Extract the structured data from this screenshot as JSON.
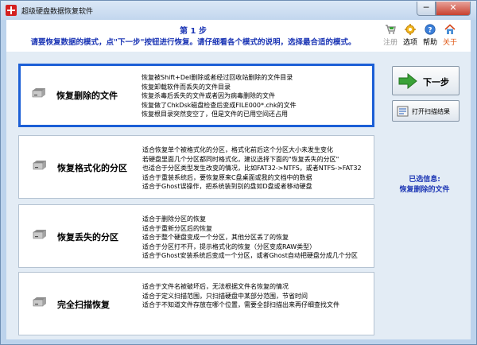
{
  "window": {
    "title": "超级硬盘数据恢复软件",
    "controls": {
      "minimize": "─",
      "close": "✕"
    }
  },
  "header": {
    "step": "第 1 步",
    "instruction": "请要恢复数据的模式，点\"下一步\"按钮进行恢复。请仔细看各个模式的说明，选择最合适的模式。"
  },
  "toolbar": {
    "register": "注册",
    "options": "选项",
    "help": "帮助",
    "about": "关于"
  },
  "options": [
    {
      "title": "恢复删除的文件",
      "lines": [
        "恢复被Shift+Del删除或者经过回收站删除的文件目录",
        "恢复卸载软件而丢失的文件目录",
        "恢复杀毒后丢失的文件或者因为病毒删除的文件",
        "恢复做了ChkDsk磁盘检查后变成FILE000*.chk的文件",
        "恢复根目录突然变空了，但是文件的已用空间还占用"
      ]
    },
    {
      "title": "恢复格式化的分区",
      "lines": [
        "适合恢复单个被格式化的分区，格式化前后这个分区大小未发生变化",
        "若硬盘里面几个分区都同时格式化，建议选择下面的\"恢复丢失的分区\"",
        "也适合于分区类型发生改变的情况，比如FAT32->NTFS，或者NTFS->FAT32",
        "适合于重装系统后，要恢复原来C盘桌面或我的文档中的数据",
        "适合于Ghost误操作，把系统装到别的盘如D盘或者移动硬盘"
      ]
    },
    {
      "title": "恢复丢失的分区",
      "lines": [
        "适合于删除分区的恢复",
        "适合于重新分区后的恢复",
        "适合于整个硬盘变成一个分区，其他分区丢了的恢复",
        "适合于分区打不开，提示格式化的恢复（分区变成RAW类型）",
        "适合于Ghost安装系统后变成一个分区，或者Ghost自动把硬盘分成几个分区"
      ]
    },
    {
      "title": "完全扫描恢复",
      "lines": [
        "适合于文件名被破坏后，无法根据文件名恢复的情况",
        "适合于定义扫描范围，只扫描硬盘中某部分范围，节省时间",
        "适合于不知道文件存放在哪个位置，需要全部扫描出来再仔细查找文件"
      ]
    }
  ],
  "actions": {
    "next": "下一步",
    "open_scan": "打开扫描结果"
  },
  "selection": {
    "caption": "已选信息:",
    "value": "恢复删除的文件"
  },
  "colors": {
    "selected_border": "#1c5fd6",
    "heading_text": "#1c36b5",
    "panel_bg": "#e3ecf5",
    "next_arrow": "#3aa238"
  },
  "icons": {
    "app": "app-icon",
    "register": "cart-icon",
    "options": "gear-icon",
    "help": "help-icon",
    "about": "house-icon",
    "option": "hard-disk-icon",
    "next": "arrow-right-icon",
    "open_scan": "open-results-icon"
  }
}
